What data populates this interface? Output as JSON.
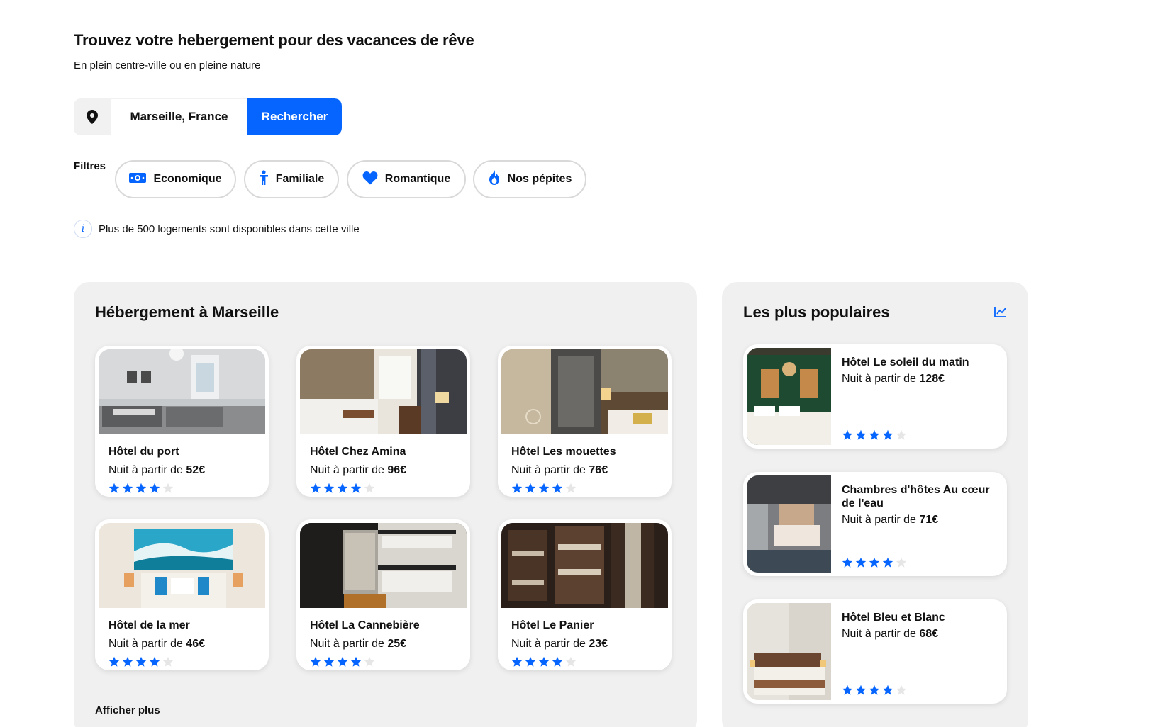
{
  "hero": {
    "title": "Trouvez votre hebergement pour des vacances de rêve",
    "subtitle": "En plein centre-ville ou en pleine nature"
  },
  "search": {
    "location": "Marseille, France",
    "button": "Rechercher",
    "icon": "location-pin-icon"
  },
  "filters": {
    "label": "Filtres",
    "items": [
      {
        "label": "Economique",
        "icon": "money-icon"
      },
      {
        "label": "Familiale",
        "icon": "child-icon"
      },
      {
        "label": "Romantique",
        "icon": "heart-icon"
      },
      {
        "label": "Nos pépites",
        "icon": "fire-icon"
      }
    ]
  },
  "info": {
    "icon": "info-icon",
    "text": "Plus de 500 logements sont disponibles dans cette ville"
  },
  "listing": {
    "title": "Hébergement à Marseille",
    "more": "Afficher plus",
    "hotels": [
      {
        "name": "Hôtel du port",
        "price_prefix": "Nuit à partir de ",
        "price": "52€",
        "rating": 4
      },
      {
        "name": "Hôtel Chez Amina",
        "price_prefix": "Nuit à partir de ",
        "price": "96€",
        "rating": 4
      },
      {
        "name": "Hôtel Les mouettes",
        "price_prefix": "Nuit à partir de ",
        "price": "76€",
        "rating": 4
      },
      {
        "name": "Hôtel de la mer",
        "price_prefix": "Nuit à partir de ",
        "price": "46€",
        "rating": 4
      },
      {
        "name": "Hôtel La Cannebière",
        "price_prefix": "Nuit à partir de ",
        "price": "25€",
        "rating": 4
      },
      {
        "name": "Hôtel Le Panier",
        "price_prefix": "Nuit à partir de ",
        "price": "23€",
        "rating": 4
      }
    ]
  },
  "popular": {
    "title": "Les plus populaires",
    "icon": "trend-chart-icon",
    "hotels": [
      {
        "name": "Hôtel Le soleil du matin",
        "price_prefix": "Nuit à partir de ",
        "price": "128€",
        "rating": 4
      },
      {
        "name": "Chambres d'hôtes Au cœur de l'eau",
        "price_prefix": "Nuit à partir de ",
        "price": "71€",
        "rating": 4
      },
      {
        "name": "Hôtel Bleu et Blanc",
        "price_prefix": "Nuit à partir de ",
        "price": "68€",
        "rating": 4
      }
    ]
  },
  "colors": {
    "accent": "#0665ff",
    "panel": "#f0f0f0",
    "star_off": "#e6e6e6"
  }
}
